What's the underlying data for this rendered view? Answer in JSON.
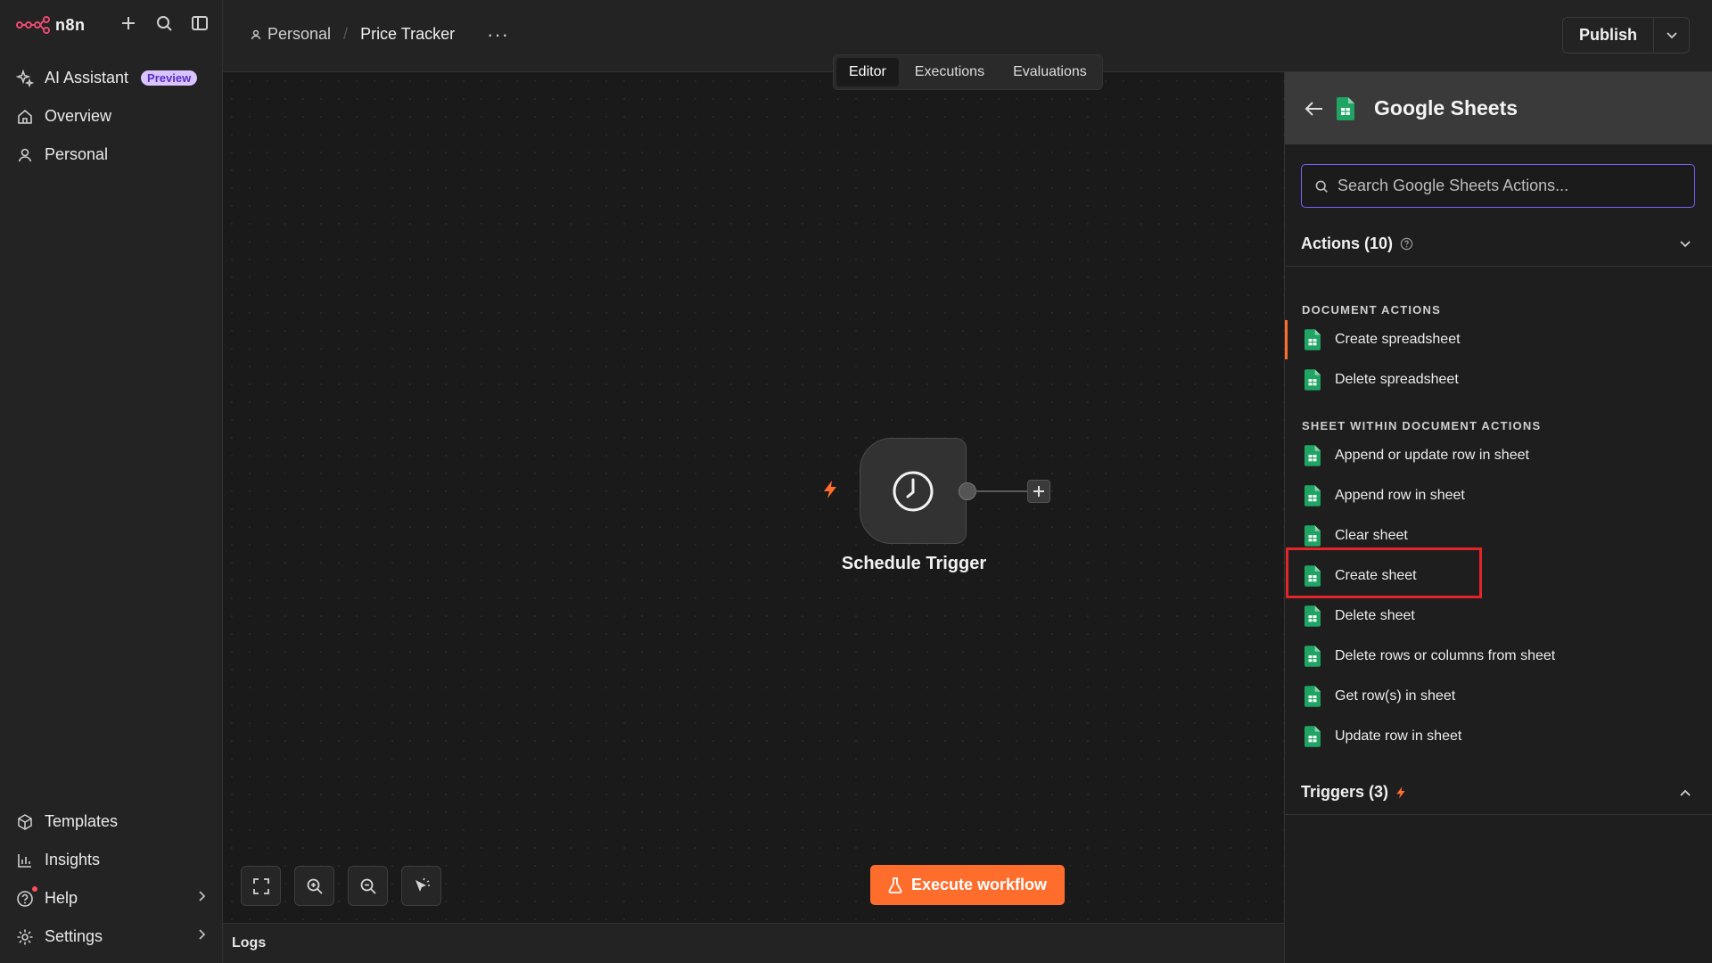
{
  "app": {
    "logo_text": "n8n"
  },
  "sidebar": {
    "items": [
      {
        "label": "AI Assistant",
        "badge": "Preview",
        "icon": "sparkle-icon"
      },
      {
        "label": "Overview",
        "icon": "home-icon"
      },
      {
        "label": "Personal",
        "icon": "user-icon"
      }
    ],
    "bottom_items": [
      {
        "label": "Templates",
        "icon": "templates-icon"
      },
      {
        "label": "Insights",
        "icon": "chart-icon"
      },
      {
        "label": "Help",
        "icon": "help-icon"
      },
      {
        "label": "Settings",
        "icon": "gear-icon"
      }
    ]
  },
  "header": {
    "project": "Personal",
    "workflow_name": "Price Tracker",
    "more": "···",
    "publish_label": "Publish"
  },
  "tabs": [
    {
      "label": "Editor",
      "active": true
    },
    {
      "label": "Executions",
      "active": false
    },
    {
      "label": "Evaluations",
      "active": false
    }
  ],
  "canvas": {
    "node_label": "Schedule Trigger",
    "execute_label": "Execute workflow",
    "logs_label": "Logs"
  },
  "panel": {
    "title": "Google Sheets",
    "search_placeholder": "Search Google Sheets Actions...",
    "actions_header": "Actions (10)",
    "triggers_header": "Triggers (3)",
    "groups": [
      {
        "title": "DOCUMENT ACTIONS",
        "items": [
          "Create spreadsheet",
          "Delete spreadsheet"
        ]
      },
      {
        "title": "SHEET WITHIN DOCUMENT ACTIONS",
        "items": [
          "Append or update row in sheet",
          "Append row in sheet",
          "Clear sheet",
          "Create sheet",
          "Delete sheet",
          "Delete rows or columns from sheet",
          "Get row(s) in sheet",
          "Update row in sheet"
        ]
      }
    ]
  },
  "colors": {
    "accent": "#ff6d2d",
    "sheets_green": "#1fa463",
    "focus": "#7b61ff",
    "highlight": "#e3252b"
  }
}
